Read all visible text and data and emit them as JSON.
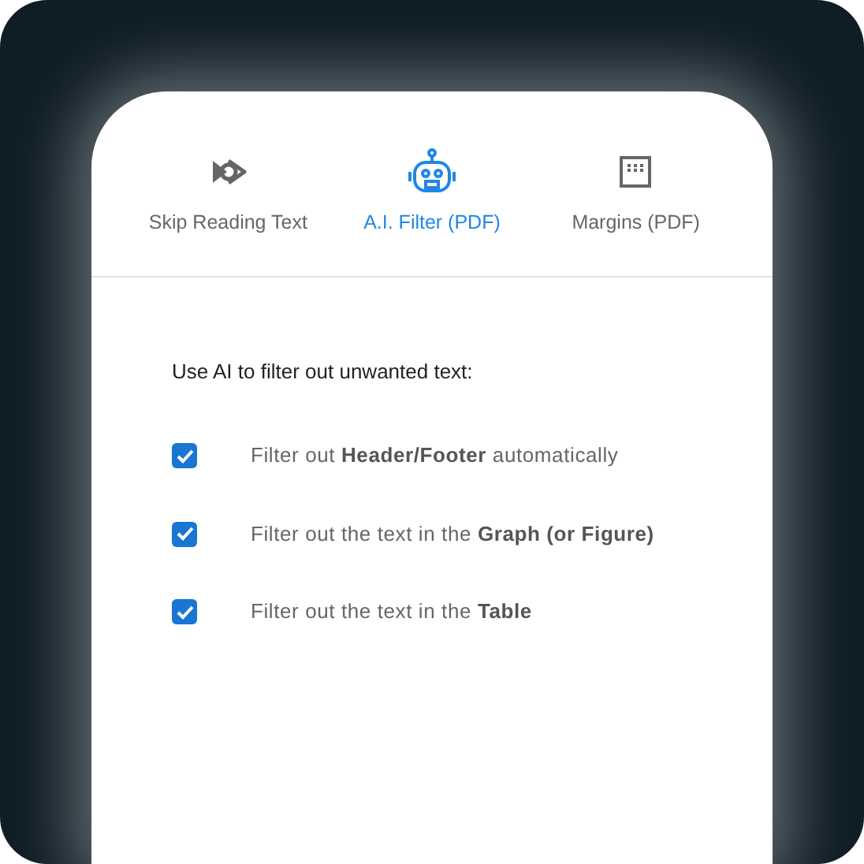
{
  "tabs": [
    {
      "label": "Skip Reading Text",
      "kind": "skip",
      "selected": false
    },
    {
      "label": "A.I. Filter (PDF)",
      "kind": "robot",
      "selected": true
    },
    {
      "label": "Margins (PDF)",
      "kind": "grid",
      "selected": false
    }
  ],
  "heading": "Use AI to filter out unwanted text:",
  "options": [
    {
      "text": "Filter out **Header/Footer** automatically",
      "checked": true
    },
    {
      "text": "Filter out the text in the **Graph (or Figure)**",
      "checked": true
    },
    {
      "text": "Filter out the text in the **Table**",
      "checked": true
    }
  ]
}
